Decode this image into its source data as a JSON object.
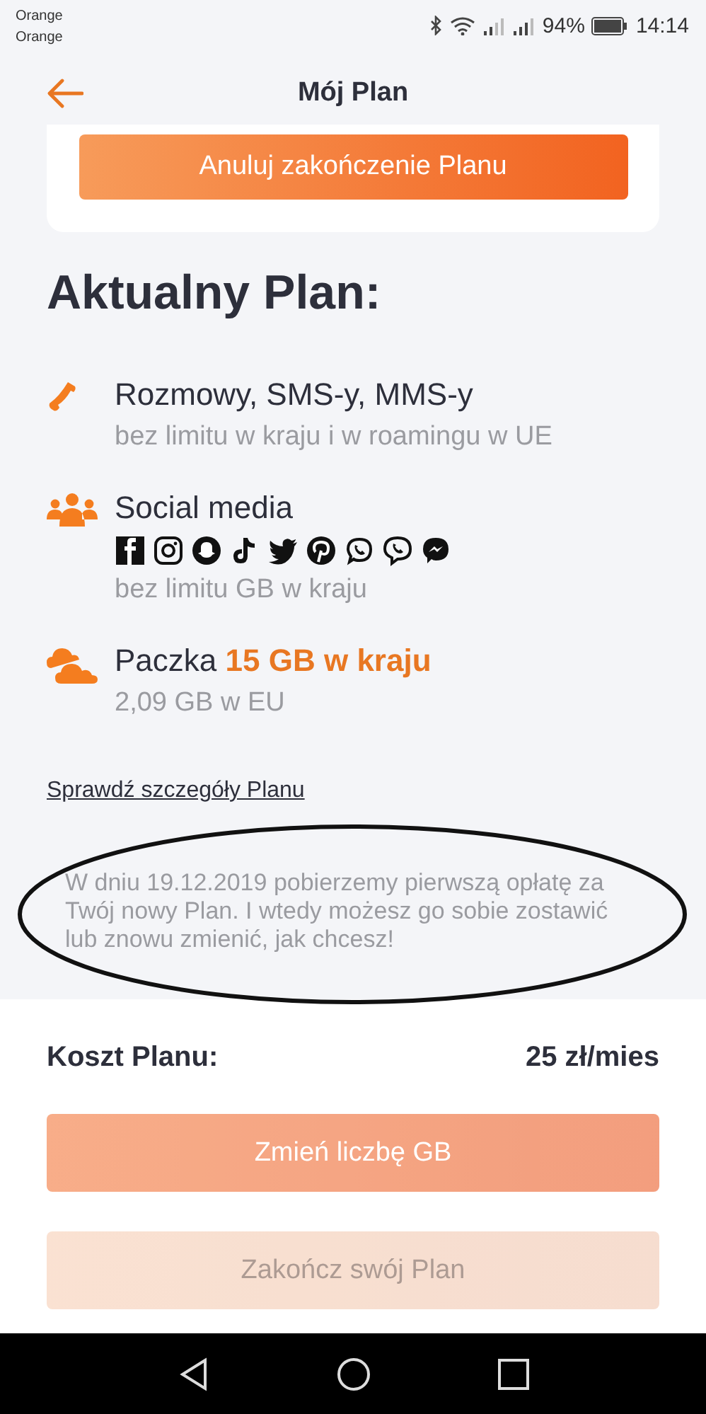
{
  "status_bar": {
    "carriers": [
      "Orange",
      "Orange"
    ],
    "battery": "94%",
    "time": "14:14"
  },
  "header": {
    "title": "Mój Plan"
  },
  "top_button": {
    "label": "Anuluj zakończenie Planu",
    "disabled": false
  },
  "heading": "Aktualny Plan:",
  "features": [
    {
      "kind": "calls",
      "title": "Rozmowy, SMS-y, MMS-y",
      "detail": "bez limitu w kraju i w roamingu w UE"
    },
    {
      "kind": "social",
      "title": "Social media",
      "detail": "bez limitu GB w kraju"
    },
    {
      "kind": "data",
      "title": "Paczka",
      "highlight": "15 GB w kraju",
      "detail": "2,09 GB w EU"
    }
  ],
  "details_link": "Sprawdź szczegóły Planu",
  "note": "W dniu 19.12.2019 pobierzemy pierwszą opłatę za Twój nowy Plan. I wtedy możesz go sobie zostawić lub znowu zmienić, jak chcesz!",
  "cost": {
    "label": "Koszt Planu:",
    "value": "25 zł/mies"
  },
  "buttons": [
    {
      "label": "Zmień liczbę GB",
      "kind": "primary",
      "disabled": true
    },
    {
      "label": "Zakończ swój Plan",
      "kind": "secondary",
      "disabled": true
    }
  ]
}
